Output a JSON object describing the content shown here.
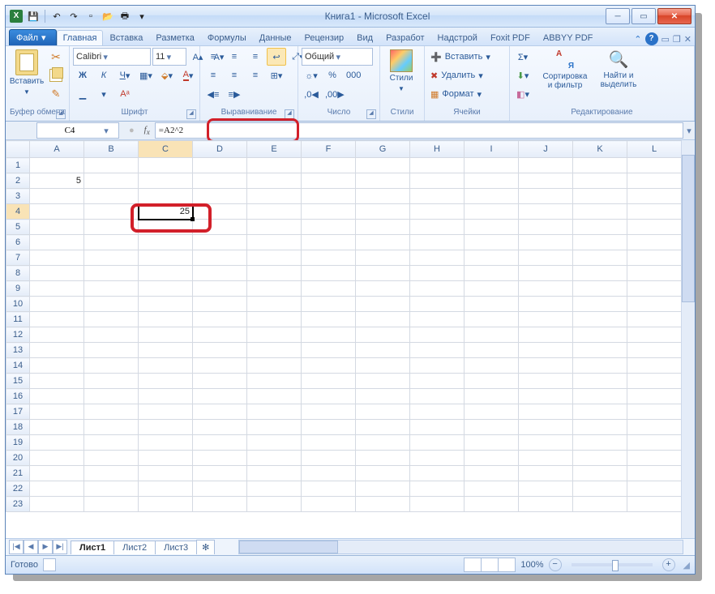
{
  "title": "Книга1 - Microsoft Excel",
  "qat_icons": [
    "excel",
    "save",
    "undo",
    "redo",
    "new",
    "open",
    "print",
    "preview"
  ],
  "tabs": {
    "file": "Файл",
    "items": [
      "Главная",
      "Вставка",
      "Разметка",
      "Формулы",
      "Данные",
      "Рецензир",
      "Вид",
      "Разработ",
      "Надстрой",
      "Foxit PDF",
      "ABBYY PDF"
    ],
    "active": 0
  },
  "ribbon": {
    "clipboard": {
      "label": "Буфер обмена",
      "paste": "Вставить"
    },
    "font": {
      "label": "Шрифт",
      "name": "Calibri",
      "size": "11"
    },
    "align": {
      "label": "Выравнивание"
    },
    "number": {
      "label": "Число",
      "format": "Общий"
    },
    "styles": {
      "label": "Стили",
      "btn": "Стили"
    },
    "cells": {
      "label": "Ячейки",
      "insert": "Вставить",
      "delete": "Удалить",
      "format": "Формат"
    },
    "editing": {
      "label": "Редактирование",
      "sort": "Сортировка\nи фильтр",
      "find": "Найти и\nвыделить"
    }
  },
  "namebox": "C4",
  "formula": "=A2^2",
  "columns": [
    "A",
    "B",
    "C",
    "D",
    "E",
    "F",
    "G",
    "H",
    "I",
    "J",
    "K",
    "L"
  ],
  "rowcount": 23,
  "selected": {
    "row": 4,
    "col": "C"
  },
  "cells": {
    "A2": "5",
    "C4": "25"
  },
  "sheets": {
    "items": [
      "Лист1",
      "Лист2",
      "Лист3"
    ],
    "active": 0
  },
  "status": {
    "ready": "Готово",
    "zoom": "100%"
  }
}
